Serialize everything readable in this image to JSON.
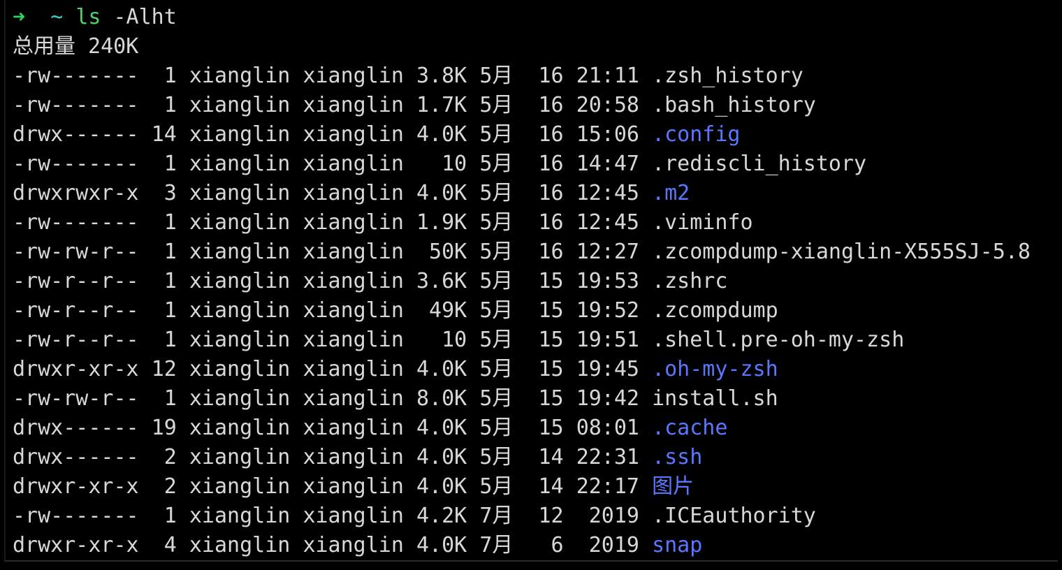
{
  "prompt": {
    "arrow": "➜",
    "cwd": "~",
    "command": "ls",
    "args": "-Alht"
  },
  "total": "总用量 240K",
  "entries": [
    {
      "perms": "-rw-------",
      "links": "1",
      "owner": "xianglin",
      "group": "xianglin",
      "size": "3.8K",
      "month": "5月",
      "day": "16",
      "time": "21:11",
      "name": ".zsh_history",
      "type": "file"
    },
    {
      "perms": "-rw-------",
      "links": "1",
      "owner": "xianglin",
      "group": "xianglin",
      "size": "1.7K",
      "month": "5月",
      "day": "16",
      "time": "20:58",
      "name": ".bash_history",
      "type": "file"
    },
    {
      "perms": "drwx------",
      "links": "14",
      "owner": "xianglin",
      "group": "xianglin",
      "size": "4.0K",
      "month": "5月",
      "day": "16",
      "time": "15:06",
      "name": ".config",
      "type": "dir"
    },
    {
      "perms": "-rw-------",
      "links": "1",
      "owner": "xianglin",
      "group": "xianglin",
      "size": "10",
      "month": "5月",
      "day": "16",
      "time": "14:47",
      "name": ".rediscli_history",
      "type": "file"
    },
    {
      "perms": "drwxrwxr-x",
      "links": "3",
      "owner": "xianglin",
      "group": "xianglin",
      "size": "4.0K",
      "month": "5月",
      "day": "16",
      "time": "12:45",
      "name": ".m2",
      "type": "dir"
    },
    {
      "perms": "-rw-------",
      "links": "1",
      "owner": "xianglin",
      "group": "xianglin",
      "size": "1.9K",
      "month": "5月",
      "day": "16",
      "time": "12:45",
      "name": ".viminfo",
      "type": "file"
    },
    {
      "perms": "-rw-rw-r--",
      "links": "1",
      "owner": "xianglin",
      "group": "xianglin",
      "size": "50K",
      "month": "5月",
      "day": "16",
      "time": "12:27",
      "name": ".zcompdump-xianglin-X555SJ-5.8",
      "type": "file"
    },
    {
      "perms": "-rw-r--r--",
      "links": "1",
      "owner": "xianglin",
      "group": "xianglin",
      "size": "3.6K",
      "month": "5月",
      "day": "15",
      "time": "19:53",
      "name": ".zshrc",
      "type": "file"
    },
    {
      "perms": "-rw-r--r--",
      "links": "1",
      "owner": "xianglin",
      "group": "xianglin",
      "size": "49K",
      "month": "5月",
      "day": "15",
      "time": "19:52",
      "name": ".zcompdump",
      "type": "file"
    },
    {
      "perms": "-rw-r--r--",
      "links": "1",
      "owner": "xianglin",
      "group": "xianglin",
      "size": "10",
      "month": "5月",
      "day": "15",
      "time": "19:51",
      "name": ".shell.pre-oh-my-zsh",
      "type": "file"
    },
    {
      "perms": "drwxr-xr-x",
      "links": "12",
      "owner": "xianglin",
      "group": "xianglin",
      "size": "4.0K",
      "month": "5月",
      "day": "15",
      "time": "19:45",
      "name": ".oh-my-zsh",
      "type": "dir"
    },
    {
      "perms": "-rw-rw-r--",
      "links": "1",
      "owner": "xianglin",
      "group": "xianglin",
      "size": "8.0K",
      "month": "5月",
      "day": "15",
      "time": "19:42",
      "name": "install.sh",
      "type": "file"
    },
    {
      "perms": "drwx------",
      "links": "19",
      "owner": "xianglin",
      "group": "xianglin",
      "size": "4.0K",
      "month": "5月",
      "day": "15",
      "time": "08:01",
      "name": ".cache",
      "type": "dir"
    },
    {
      "perms": "drwx------",
      "links": "2",
      "owner": "xianglin",
      "group": "xianglin",
      "size": "4.0K",
      "month": "5月",
      "day": "14",
      "time": "22:31",
      "name": ".ssh",
      "type": "dir"
    },
    {
      "perms": "drwxr-xr-x",
      "links": "2",
      "owner": "xianglin",
      "group": "xianglin",
      "size": "4.0K",
      "month": "5月",
      "day": "14",
      "time": "22:17",
      "name": "图片",
      "type": "dir"
    },
    {
      "perms": "-rw-------",
      "links": "1",
      "owner": "xianglin",
      "group": "xianglin",
      "size": "4.2K",
      "month": "7月",
      "day": "12",
      "time": "2019",
      "name": ".ICEauthority",
      "type": "file"
    },
    {
      "perms": "drwxr-xr-x",
      "links": "4",
      "owner": "xianglin",
      "group": "xianglin",
      "size": "4.0K",
      "month": "7月",
      "day": "6",
      "time": "2019",
      "name": "snap",
      "type": "dir"
    }
  ],
  "colors": {
    "background": "#000000",
    "text": "#d8d8d8",
    "prompt_arrow": "#2fd35b",
    "prompt_cwd": "#46c9c8",
    "command": "#4fd36a",
    "directory": "#5a78ff"
  }
}
